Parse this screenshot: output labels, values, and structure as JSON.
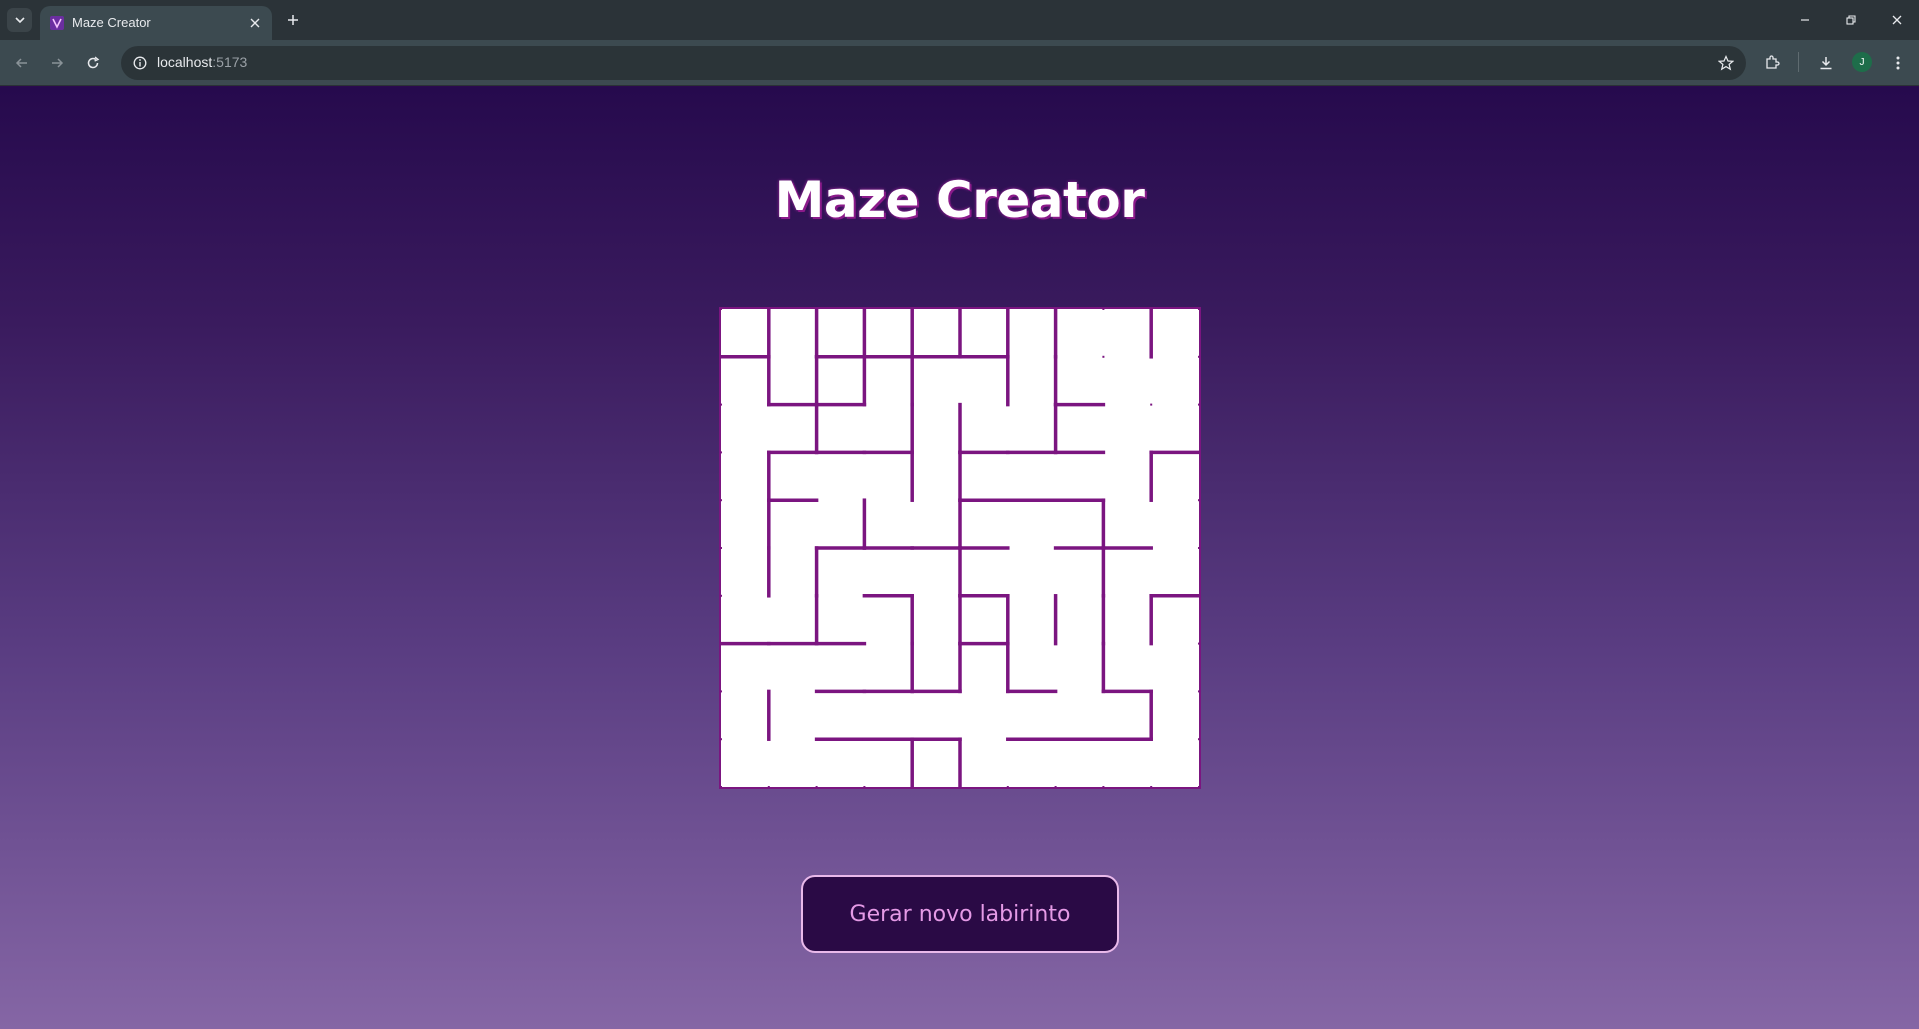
{
  "browser": {
    "tab_title": "Maze Creator",
    "url_host": "localhost",
    "url_port": ":5173",
    "profile_initial": "J"
  },
  "page": {
    "title": "Maze Creator",
    "button_label": "Gerar novo labirinto"
  },
  "maze": {
    "rows": 10,
    "cols": 10,
    "wall_color": "#7b1580",
    "background": "#ffffff",
    "walls": [
      [
        1,
        0,
        1,
        1
      ],
      [
        0,
        1,
        1,
        1
      ],
      [
        0,
        2,
        1,
        2
      ],
      [
        0,
        3,
        1,
        3
      ],
      [
        0,
        4,
        1,
        4
      ],
      [
        0,
        5,
        1,
        5
      ],
      [
        0,
        6,
        1,
        6
      ],
      [
        0,
        7,
        1,
        7
      ],
      [
        0,
        9,
        1,
        9
      ],
      [
        1,
        1,
        2,
        1
      ],
      [
        1,
        2,
        1,
        3
      ],
      [
        1,
        2,
        2,
        2
      ],
      [
        1,
        3,
        1,
        4
      ],
      [
        1,
        3,
        2,
        3
      ],
      [
        1,
        4,
        1,
        5
      ],
      [
        1,
        4,
        2,
        4
      ],
      [
        1,
        5,
        1,
        6
      ],
      [
        1,
        6,
        2,
        6
      ],
      [
        1,
        7,
        2,
        7
      ],
      [
        2,
        1,
        2,
        2
      ],
      [
        2,
        2,
        2,
        3
      ],
      [
        2,
        7,
        2,
        8
      ],
      [
        2,
        2,
        3,
        2
      ],
      [
        2,
        4,
        3,
        4
      ],
      [
        2,
        5,
        3,
        5
      ],
      [
        2,
        7,
        3,
        7
      ],
      [
        3,
        1,
        3,
        2
      ],
      [
        3,
        2,
        3,
        3
      ],
      [
        3,
        3,
        3,
        4
      ],
      [
        3,
        5,
        3,
        6
      ],
      [
        3,
        6,
        3,
        7
      ],
      [
        3,
        7,
        3,
        8
      ],
      [
        3,
        9,
        3,
        10
      ],
      [
        3,
        1,
        4,
        1
      ],
      [
        3,
        4,
        4,
        4
      ],
      [
        3,
        5,
        4,
        5
      ],
      [
        3,
        9,
        4,
        9
      ],
      [
        4,
        1,
        4,
        2
      ],
      [
        4,
        5,
        4,
        6
      ],
      [
        4,
        6,
        4,
        7
      ],
      [
        4,
        7,
        4,
        8
      ],
      [
        4,
        1,
        5,
        1
      ],
      [
        4,
        3,
        5,
        3
      ],
      [
        4,
        5,
        5,
        5
      ],
      [
        4,
        8,
        5,
        8
      ],
      [
        5,
        2,
        5,
        3
      ],
      [
        5,
        3,
        5,
        4
      ],
      [
        5,
        4,
        5,
        5
      ],
      [
        5,
        5,
        5,
        6
      ],
      [
        5,
        7,
        5,
        8
      ],
      [
        5,
        8,
        5,
        9
      ],
      [
        5,
        1,
        6,
        1
      ],
      [
        5,
        2,
        6,
        2
      ],
      [
        5,
        5,
        6,
        5
      ],
      [
        5,
        8,
        6,
        8
      ],
      [
        6,
        3,
        6,
        4
      ],
      [
        6,
        5,
        6,
        6
      ],
      [
        6,
        9,
        6,
        10
      ],
      [
        6,
        2,
        7,
        2
      ],
      [
        6,
        4,
        7,
        4
      ],
      [
        6,
        5,
        7,
        5
      ],
      [
        6,
        6,
        7,
        6
      ],
      [
        6,
        7,
        7,
        7
      ],
      [
        6,
        8,
        7,
        8
      ],
      [
        6,
        9,
        7,
        9
      ],
      [
        7,
        0,
        7,
        1
      ],
      [
        7,
        1,
        7,
        2
      ],
      [
        7,
        2,
        7,
        3
      ],
      [
        7,
        5,
        7,
        6
      ],
      [
        7,
        4,
        8,
        4
      ],
      [
        7,
        5,
        8,
        5
      ],
      [
        7,
        6,
        8,
        6
      ],
      [
        7,
        8,
        8,
        8
      ],
      [
        8,
        2,
        8,
        3
      ],
      [
        8,
        3,
        8,
        4
      ],
      [
        8,
        4,
        8,
        5
      ],
      [
        8,
        6,
        8,
        7
      ],
      [
        8,
        8,
        8,
        9
      ],
      [
        8,
        1,
        9,
        1
      ],
      [
        8,
        9,
        9,
        9
      ],
      [
        9,
        2,
        9,
        3
      ],
      [
        9,
        3,
        9,
        4
      ],
      [
        9,
        4,
        9,
        5
      ],
      [
        9,
        6,
        9,
        7
      ],
      [
        9,
        7,
        9,
        8
      ],
      [
        9,
        8,
        9,
        9
      ],
      [
        9,
        4,
        10,
        4
      ],
      [
        9,
        5,
        10,
        5
      ]
    ]
  }
}
